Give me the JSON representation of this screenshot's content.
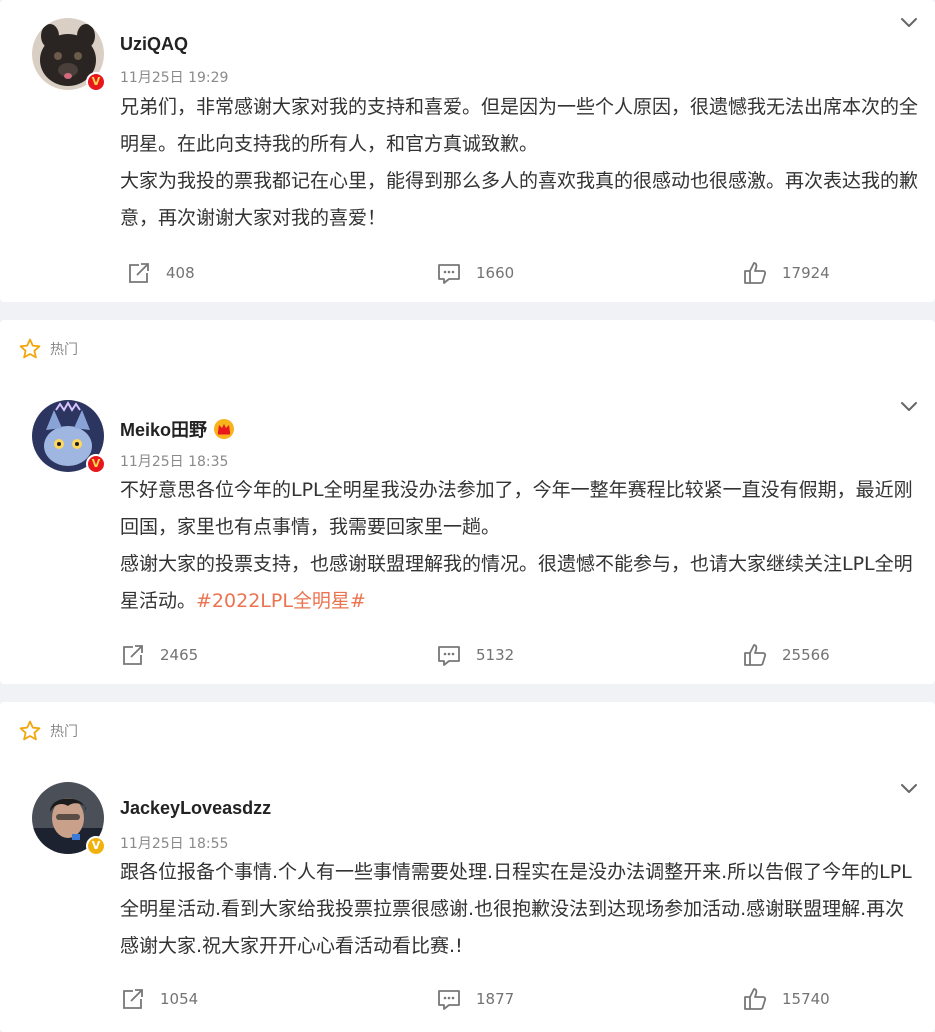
{
  "posts": [
    {
      "hot_label": "",
      "username": "UziQAQ",
      "timestamp": "11月25日 19:29",
      "paragraphs": [
        "兄弟们，非常感谢大家对我的支持和喜爱。但是因为一些个人原因，很遗憾我无法出席本次的全明星。在此向支持我的所有人，和官方真诚致歉。",
        "大家为我投的票我都记在心里，能得到那么多人的喜欢我真的很感动也很感激。再次表达我的歉意，再次谢谢大家对我的喜爱！"
      ],
      "reposts": "408",
      "comments": "1660",
      "likes": "17924",
      "badge": "V"
    },
    {
      "hot_label": "热门",
      "username": "Meiko田野",
      "timestamp": "11月25日 18:35",
      "paragraphs": [
        "不好意思各位今年的LPL全明星我没办法参加了，今年一整年赛程比较紧一直没有假期，最近刚回国，家里也有点事情，我需要回家里一趟。",
        "感谢大家的投票支持，也感谢联盟理解我的情况。很遗憾不能参与，也请大家继续关注LPL全明星活动。"
      ],
      "topic": "#2022LPL全明星#",
      "reposts": "2465",
      "comments": "5132",
      "likes": "25566",
      "badge": "V"
    },
    {
      "hot_label": "热门",
      "username": "JackeyLoveasdzz",
      "timestamp": "11月25日 18:55",
      "paragraphs": [
        "跟各位报备个事情.个人有一些事情需要处理.日程实在是没办法调整开来.所以告假了今年的LPL全明星活动.看到大家给我投票拉票很感谢.也很抱歉没法到达现场参加活动.感谢联盟理解.再次感谢大家.祝大家开开心心看活动看比赛.!"
      ],
      "reposts": "1054",
      "comments": "1877",
      "likes": "15740",
      "badge": "V"
    }
  ],
  "icons": {
    "repost": "repost-icon",
    "comment": "comment-icon",
    "like": "like-icon",
    "hot": "star-icon",
    "more": "chevron-down-icon"
  },
  "colors": {
    "topic": "#eb7350",
    "verified_red": "#e8171d",
    "verified_gold": "#f2b20d",
    "hot_star": "#f2a60c"
  }
}
